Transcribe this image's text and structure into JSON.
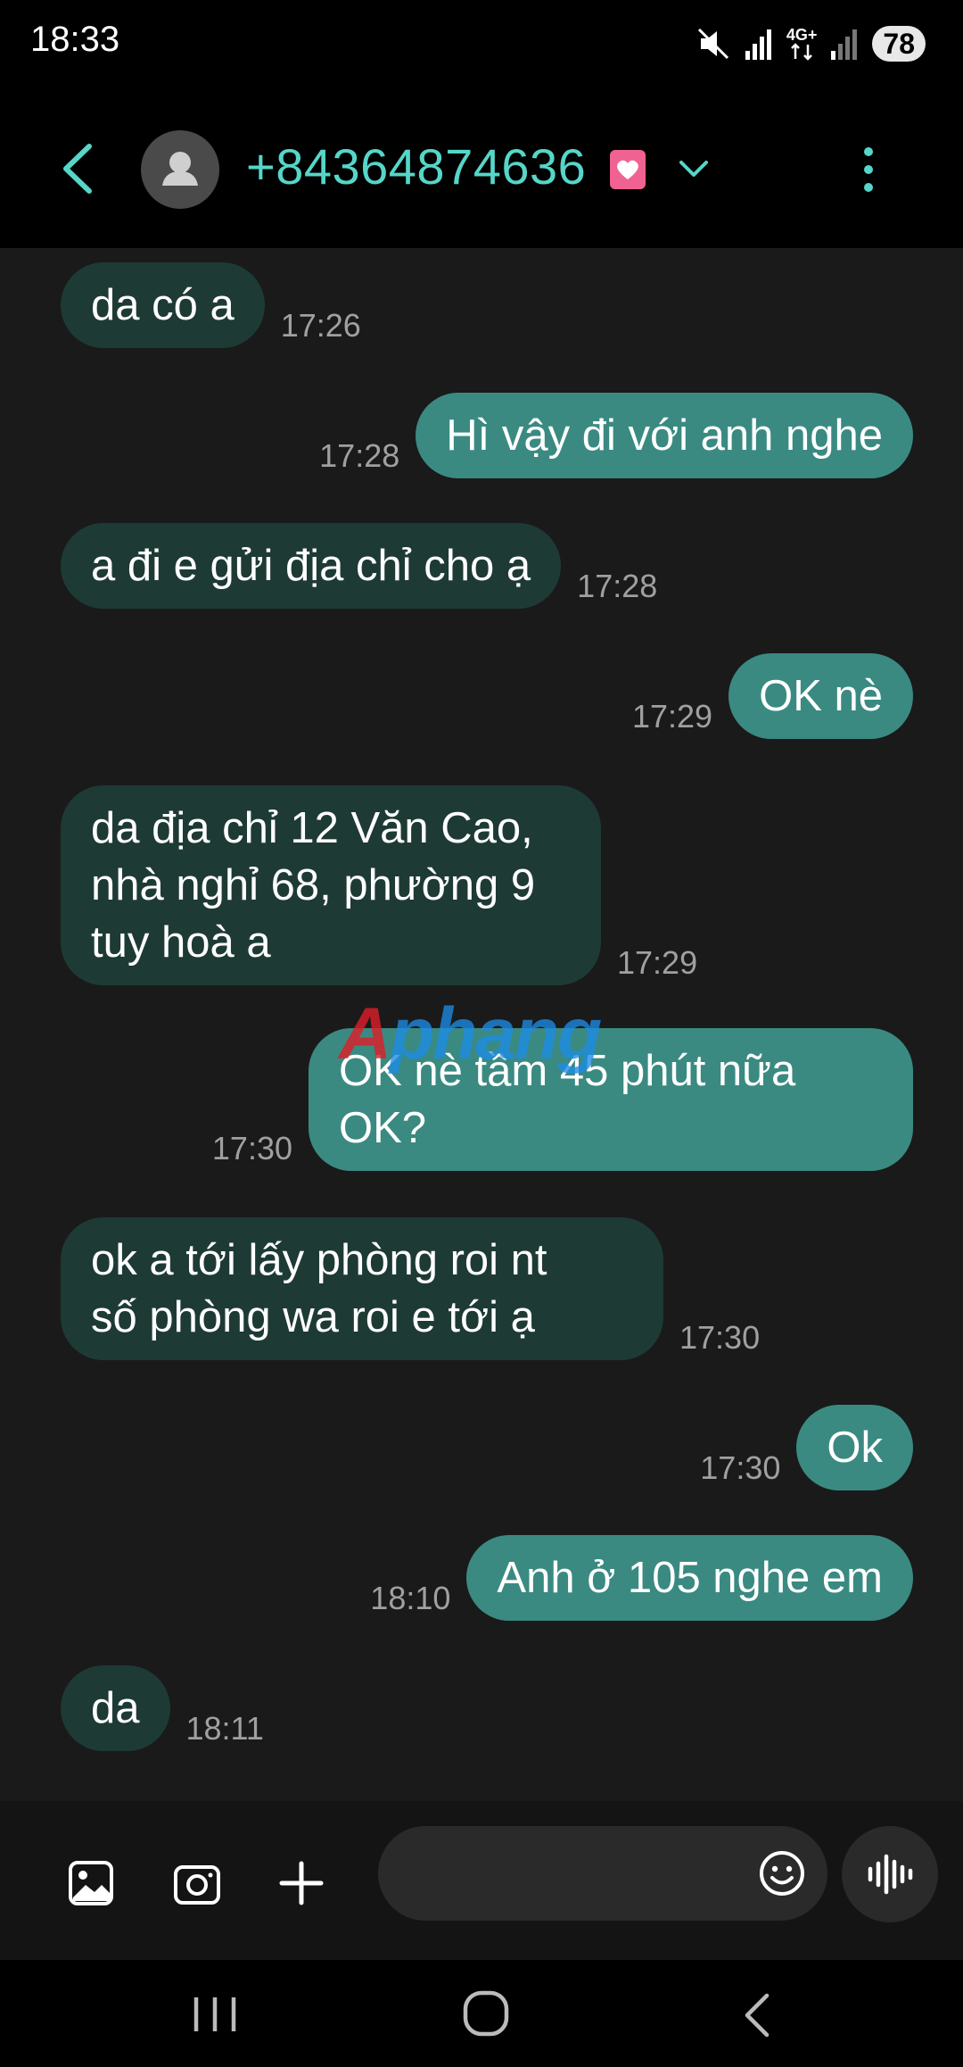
{
  "status_bar": {
    "time": "18:33",
    "network_label": "4G+",
    "battery": "78"
  },
  "header": {
    "contact": "+84364874636",
    "icons": [
      "back-icon",
      "avatar-icon",
      "heart-badge-icon",
      "chevron-down-icon",
      "more-vert-icon"
    ]
  },
  "messages": [
    {
      "dir": "in",
      "text": "da có a",
      "time": "17:26"
    },
    {
      "dir": "out",
      "text": "Hì vậy đi với anh nghe",
      "time": "17:28"
    },
    {
      "dir": "in",
      "text": "a đi e gửi địa chỉ cho ạ",
      "time": "17:28"
    },
    {
      "dir": "out",
      "text": "OK nè",
      "time": "17:29"
    },
    {
      "dir": "in",
      "text": "da địa chỉ 12 Văn Cao,\nnhà nghỉ 68, phường 9\ntuy hoà a",
      "time": "17:29"
    },
    {
      "dir": "out",
      "text": "OK nè tầm 45 phút nữa\nOK?",
      "time": "17:30"
    },
    {
      "dir": "in",
      "text": "ok a tới lấy phòng roi nt\nsố phòng wa roi e tới ạ",
      "time": "17:30"
    },
    {
      "dir": "out",
      "text": "Ok",
      "time": "17:30"
    },
    {
      "dir": "out",
      "text": "Anh ở 105 nghe em",
      "time": "18:10"
    },
    {
      "dir": "in",
      "text": "da",
      "time": "18:11"
    }
  ],
  "watermark": {
    "first": "A",
    "rest": "phang"
  },
  "input_bar": {
    "message_value": "",
    "icons": [
      "gallery-icon",
      "camera-icon",
      "plus-icon",
      "emoji-icon",
      "voice-icon"
    ]
  },
  "nav_bar": {
    "icons": [
      "recents-icon",
      "home-icon",
      "back-nav-icon"
    ]
  },
  "colors": {
    "background": "#1a1a1a",
    "incoming_bubble": "#1e3a35",
    "outgoing_bubble": "#3a8a82",
    "accent": "#55d6c8"
  }
}
